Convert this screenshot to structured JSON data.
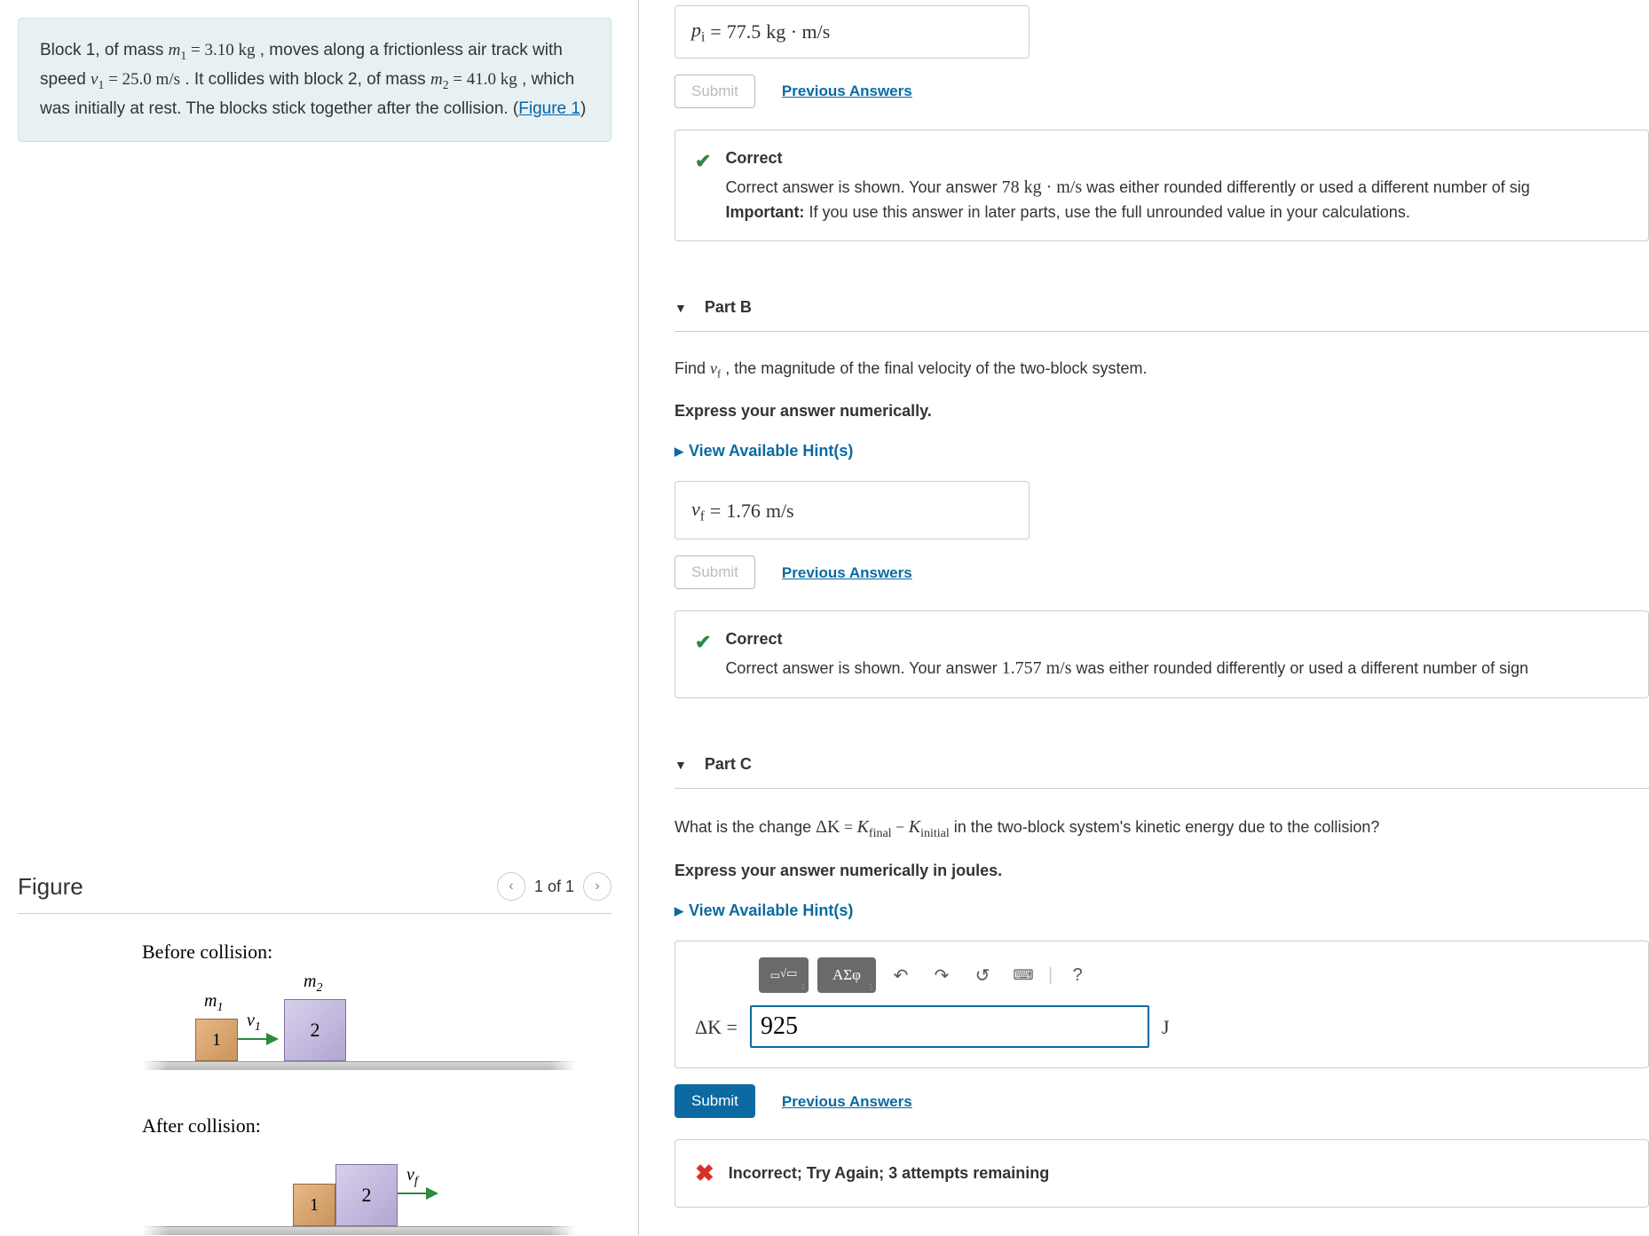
{
  "problem": {
    "text_prefix": "Block 1, of mass ",
    "m1_sym": "m",
    "m1_sub": "1",
    "m1_val": " = 3.10 ",
    "m1_unit": "kg",
    "text2": " , moves along a frictionless air track with speed ",
    "v1_sym": "v",
    "v1_sub": "1",
    "v1_val": " = 25.0 ",
    "v1_unit": "m/s",
    "text3": " . It collides with block 2, of mass ",
    "m2_sym": "m",
    "m2_sub": "2",
    "m2_val": " = 41.0 ",
    "m2_unit": "kg",
    "text4": " , which was initially at rest. The blocks stick together after the collision. (",
    "fig_link": "Figure 1",
    "text5": ")"
  },
  "figure": {
    "title": "Figure",
    "counter": "1 of 1",
    "before_label": "Before collision:",
    "after_label": "After collision:",
    "m1": "m",
    "m1s": "1",
    "m2": "m",
    "m2s": "2",
    "v1": "v",
    "v1s": "1",
    "vf": "v",
    "vfs": "f",
    "b1": "1",
    "b2": "2"
  },
  "partA": {
    "answer_sym": "p",
    "answer_sub": "i",
    "answer_eq": " = ",
    "answer_val": "77.5 ",
    "answer_unit": "kg · m/s",
    "submit": "Submit",
    "prev": "Previous Answers",
    "fb_title": "Correct",
    "fb_line1a": "Correct answer is shown. Your answer ",
    "fb_ans": "78 kg · m/s",
    "fb_line1b": " was either rounded differently or used a different number of sig",
    "fb_line2a": "Important:",
    "fb_line2b": " If you use this answer in later parts, use the full unrounded value in your calculations."
  },
  "partB": {
    "header": "Part B",
    "q1": "Find ",
    "q_sym": "v",
    "q_sub": "f",
    "q2": " , the magnitude of the final velocity of the two-block system.",
    "instruct": "Express your answer numerically.",
    "hints": "View Available Hint(s)",
    "answer_sym": "v",
    "answer_sub": "f",
    "answer_eq": " = ",
    "answer_val": "1.76 ",
    "answer_unit": "m/s",
    "submit": "Submit",
    "prev": "Previous Answers",
    "fb_title": "Correct",
    "fb_line1a": "Correct answer is shown. Your answer ",
    "fb_ans": "1.757 m/s",
    "fb_line1b": " was either rounded differently or used a different number of sign"
  },
  "partC": {
    "header": "Part C",
    "q1": "What is the change ",
    "dK": "ΔK",
    "eq": " = ",
    "Kf": "K",
    "Kf_sub": "final",
    "minus": " − ",
    "Ki": "K",
    "Ki_sub": "initial",
    "q2": " in the two-block system's kinetic energy due to the collision?",
    "instruct": "Express your answer numerically in joules.",
    "hints": "View Available Hint(s)",
    "toolbar": {
      "templates": "templates",
      "symbols": "ΑΣφ",
      "undo": "↶",
      "redo": "↷",
      "reset": "↺",
      "keyboard": "⌨",
      "help": "?"
    },
    "input_sym": "ΔK",
    "input_eq": " = ",
    "input_val": "925",
    "unit": "J",
    "submit": "Submit",
    "prev": "Previous Answers",
    "fb_title": "Incorrect; Try Again; 3 attempts remaining"
  }
}
